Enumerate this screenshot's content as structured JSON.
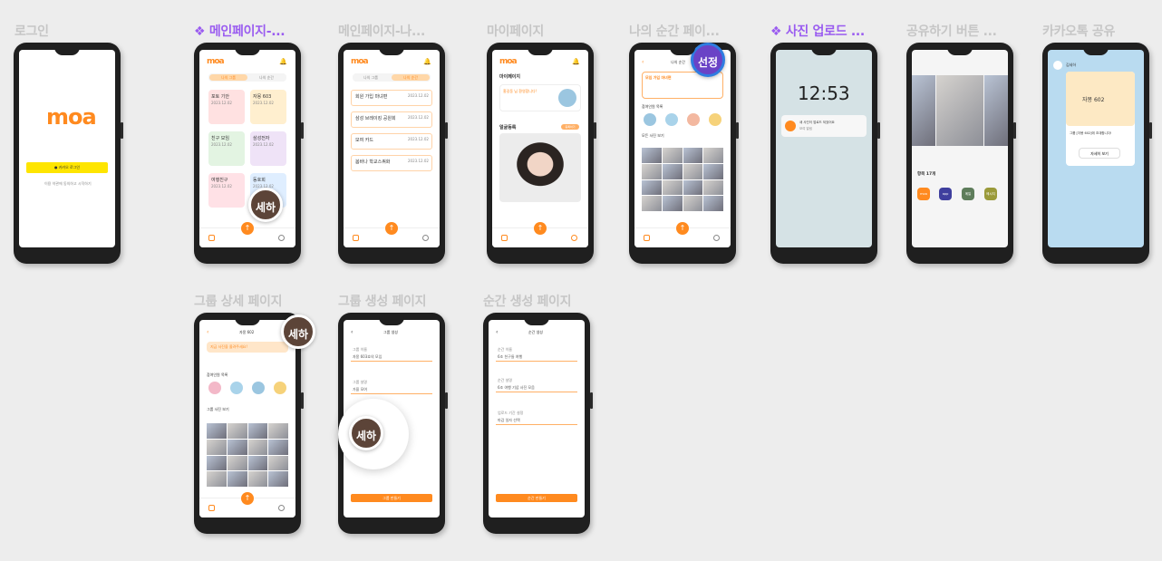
{
  "frames": [
    {
      "id": "login",
      "label": "로그인",
      "active": false
    },
    {
      "id": "main1",
      "label": "메인페이지-...",
      "active": true
    },
    {
      "id": "main2",
      "label": "메인페이지-나...",
      "active": false
    },
    {
      "id": "mypage",
      "label": "마이페이지",
      "active": false
    },
    {
      "id": "moment",
      "label": "나의 순간 페이...",
      "active": false
    },
    {
      "id": "upload",
      "label": "사진 업로드 ...",
      "active": true
    },
    {
      "id": "share",
      "label": "공유하기 버튼 ...",
      "active": false
    },
    {
      "id": "kakao",
      "label": "카카오톡 공유",
      "active": false
    },
    {
      "id": "group_detail",
      "label": "그룹 상세 페이지",
      "active": false
    },
    {
      "id": "group_create",
      "label": "그룹 생성 페이지",
      "active": false
    },
    {
      "id": "moment_create",
      "label": "순간 생성 페이지",
      "active": false
    }
  ],
  "logo": "moa",
  "login": {
    "kakao_button": "카카오 로그인",
    "sub": "이용 약관에 동의하고 시작하기"
  },
  "main1": {
    "tab_all": "나의 그룹",
    "tab_mine": "나의 순간",
    "cards": [
      {
        "title": "포토 기안",
        "sub": "2023.12.02",
        "color": "#ffe1e1"
      },
      {
        "title": "자몽 603",
        "sub": "2023.12.02",
        "color": "#ffefcf"
      },
      {
        "title": "친구 모임",
        "sub": "2023.12.02",
        "color": "#e3f4e2"
      },
      {
        "title": "삼성전자",
        "sub": "2023.12.02",
        "color": "#efe3f7"
      },
      {
        "title": "여행친구",
        "sub": "2023.12.02",
        "color": "#ffe1e6"
      },
      {
        "title": "동호회",
        "sub": "2023.12.02",
        "color": "#dfeeff"
      }
    ],
    "badge": "세하"
  },
  "main2": {
    "tab_all": "나의 그룹",
    "tab_mine": "나의 순간",
    "rows": [
      {
        "title": "회원 가입 마녀편",
        "date": "2023.12.02"
      },
      {
        "title": "삼성 브레이킹 공원회",
        "date": "2023.12.02"
      },
      {
        "title": "모여 카드",
        "date": "2023.12.02"
      },
      {
        "title": "봄바나 학교스쿼화",
        "date": "2023.12.02"
      }
    ]
  },
  "mypage": {
    "title": "마이페이지",
    "profile_name": "홍길동 님 환영합니다!",
    "section": "얼굴등록",
    "tag": "등록하기"
  },
  "moment": {
    "header": "나의 순간",
    "title": "모임 가입 마녀편",
    "section1": "참여인원 목록",
    "section2": "모든 사진 보기",
    "badge": "선정"
  },
  "upload": {
    "time": "12:53",
    "notif_title": "새 사진이 업로드 되었어요",
    "notif_sub": "모여 알림"
  },
  "share": {
    "title": "항목 17개",
    "apps": [
      "moa",
      "app",
      "메일",
      "메시지"
    ]
  },
  "kakao": {
    "user": "김세하",
    "card_title": "자몽 602",
    "card_sub": "그룹 [자몽 602]에 초대합니다!",
    "button": "자세히 보기"
  },
  "group_detail": {
    "header": "자몽 602",
    "banner": "지금 사진을 올려주세요!",
    "section1": "참여인원 목록",
    "section2": "그룹 사진 보기",
    "badge": "세하"
  },
  "group_create": {
    "header": "그룹 생성",
    "label1": "그룹 이름",
    "value1": "자몽 603호의 모임",
    "label2": "그룹 설명",
    "value2": "가을 모여",
    "button": "그룹 만들기",
    "badge": "세하"
  },
  "moment_create": {
    "header": "순간 생성",
    "label1": "순간 이름",
    "value1": "6조 친구들 여행",
    "label2": "순간 설명",
    "value2": "6조 여행 기념 사진 모음",
    "label3": "업로드 기간 설정",
    "value3": "마감 일자 선택",
    "button": "순간 만들기"
  },
  "colors": {
    "accent": "#ff8a1f",
    "purple": "#9a5cf0",
    "kakao": "#fee500"
  }
}
